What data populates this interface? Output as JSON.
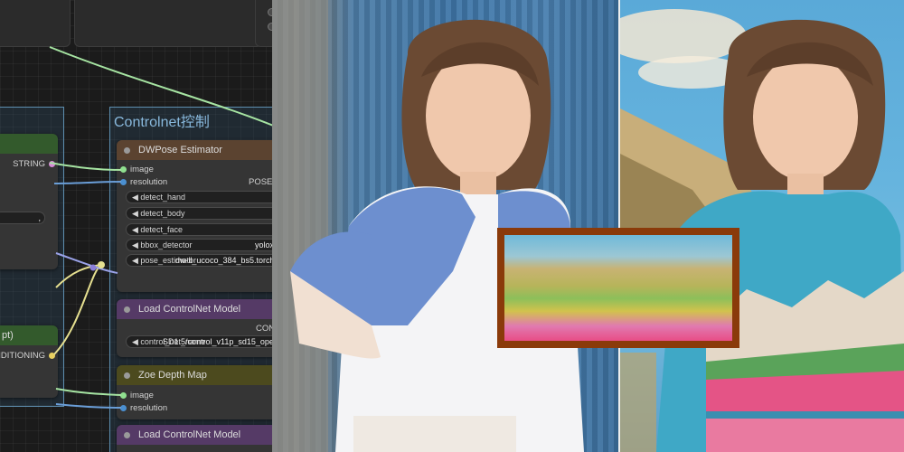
{
  "groups": {
    "controlnet": {
      "title": "Controlnet控制"
    }
  },
  "nodes": {
    "string_node": {
      "output_label": "STRING",
      "widget_value": ","
    },
    "prompt_node": {
      "title": "pt)",
      "output_label": "NDITIONING"
    },
    "dwpose": {
      "title": "DWPose Estimator",
      "inputs": [
        "image",
        "resolution"
      ],
      "output_label": "POSE",
      "widgets": [
        {
          "label": "detect_hand",
          "value": ""
        },
        {
          "label": "detect_body",
          "value": ""
        },
        {
          "label": "detect_face",
          "value": ""
        },
        {
          "label": "bbox_detector",
          "value": "yolox_"
        },
        {
          "label": "pose_estimator",
          "value": "dw-ll_ucoco_384_bs5.torchs"
        }
      ]
    },
    "load_controlnet_1": {
      "title": "Load ControlNet Model",
      "output_label": "CON",
      "widget_label": "control_net_name",
      "widget_value": "SD1.5/control_v11p_sd15_openpo"
    },
    "zoe_depth": {
      "title": "Zoe Depth Map",
      "inputs": [
        "image",
        "resolution"
      ]
    },
    "load_controlnet_2": {
      "title": "Load ControlNet Model"
    }
  },
  "colors": {
    "group_border": "#5e8fb0",
    "header_dwpose": "#5b4330",
    "header_controlnet": "#553a66",
    "header_zoe": "#4c4a1e",
    "header_green": "#335a2c",
    "socket_image": "#8fe08f",
    "socket_int": "#4a8fd0",
    "socket_string": "#d88ad8",
    "socket_conditioning": "#e8d060",
    "wire_image": "#a6e4a2",
    "wire_conditioning": "#e6e090",
    "wire_int": "#6a9ed8",
    "inset_frame": "#8a3a0a"
  },
  "images": {
    "photo_original": "photo-woman-blue-shirt-icon",
    "photo_stylized": "painted-woman-teal-shirt-icon",
    "style_reference": "painted-landscape-icon"
  }
}
